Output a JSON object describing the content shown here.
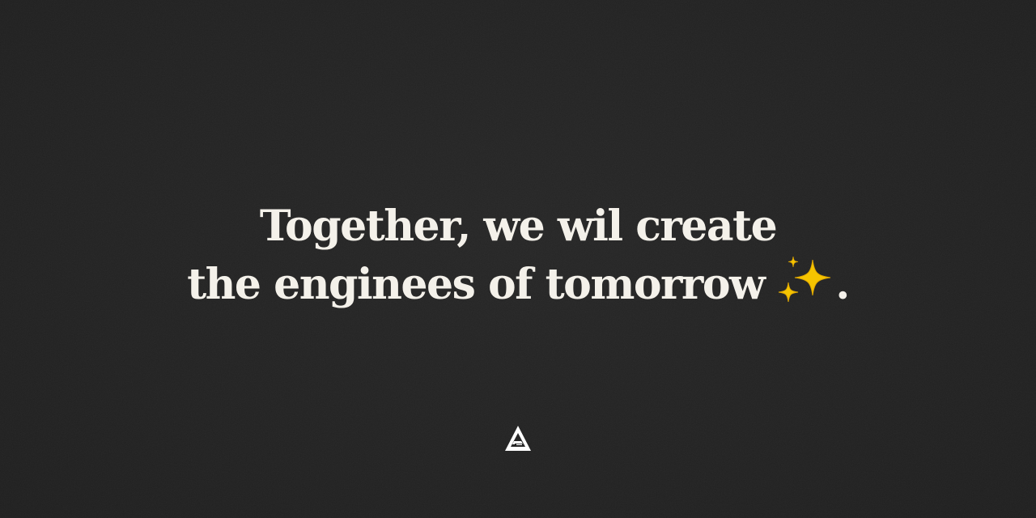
{
  "headline": {
    "line1": "Together, we wil create",
    "line2_text": "the enginees of tomorrow",
    "line2_end": ".",
    "emoji": "sparkles-icon"
  },
  "logo": {
    "icon": "brand-triangle-logo-icon"
  },
  "colors": {
    "background": "#222222",
    "text": "#f4f1ea",
    "sparkle": "#f5c400",
    "logo": "#ffffff"
  }
}
